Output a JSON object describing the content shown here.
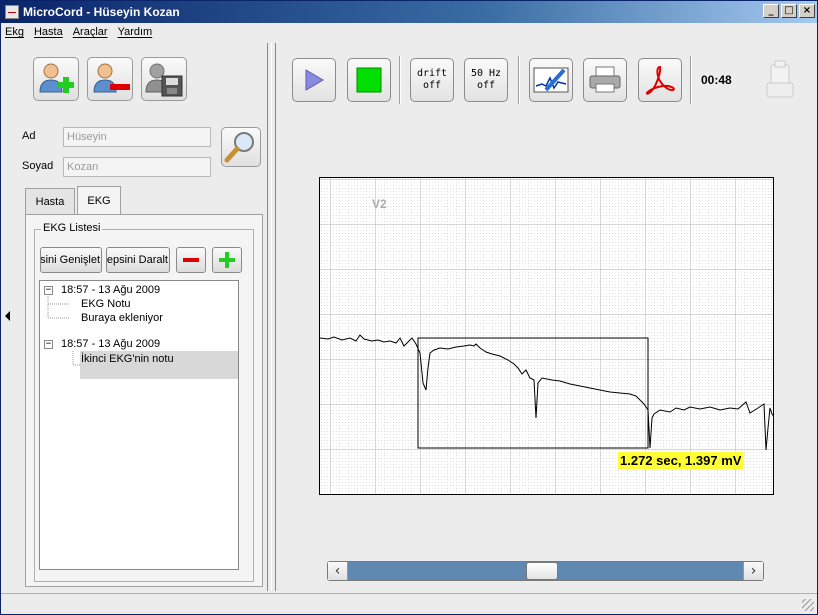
{
  "window": {
    "title": "MicroCord - Hüseyin Kozan"
  },
  "menu": [
    {
      "label": "Ekg"
    },
    {
      "label": "Hasta"
    },
    {
      "label": "Araçlar"
    },
    {
      "label": "Yardım"
    }
  ],
  "patient": {
    "first_name_label": "Ad",
    "first_name_value": "Hüseyin",
    "last_name_label": "Soyad",
    "last_name_value": "Kozan"
  },
  "tabs": [
    {
      "label": "Hasta",
      "active": false
    },
    {
      "label": "EKG",
      "active": true
    }
  ],
  "ekg_list": {
    "legend": "EKG Listesi",
    "expand_all_label": "Hepsini Genişlet",
    "collapse_all_label": "Hepsini Daralt",
    "entries": [
      {
        "title": "18:57 - 13 Ağu 2009",
        "notes": [
          "EKG Notu",
          "Buraya ekleniyor"
        ]
      },
      {
        "title": "18:57 - 13 Ağu 2009",
        "notes": [
          "İkinci EKG'nin notu"
        ]
      }
    ]
  },
  "toolbar": {
    "drift_label": "drift\noff",
    "filter_label": "50 Hz\noff",
    "elapsed_time": "00:48"
  },
  "ecg": {
    "lead": "V2",
    "measurement": "1.272 sec, 1.397 mV"
  },
  "colors": {
    "titlebar": "#0a246a",
    "record_button": "#00e000",
    "play_button": "#8a8ae0",
    "remove_button": "#dd0000",
    "add_button": "#22cc22",
    "measure_highlight": "#ffff33",
    "scroll_track": "#5f89b0"
  },
  "icons": [
    "add-patient-icon",
    "remove-patient-icon",
    "save-patient-icon",
    "search-icon",
    "play-icon",
    "record-icon",
    "ecg-note-icon",
    "printer-icon",
    "pdf-icon",
    "usb-device-icon",
    "collapse-arrow-icon"
  ]
}
